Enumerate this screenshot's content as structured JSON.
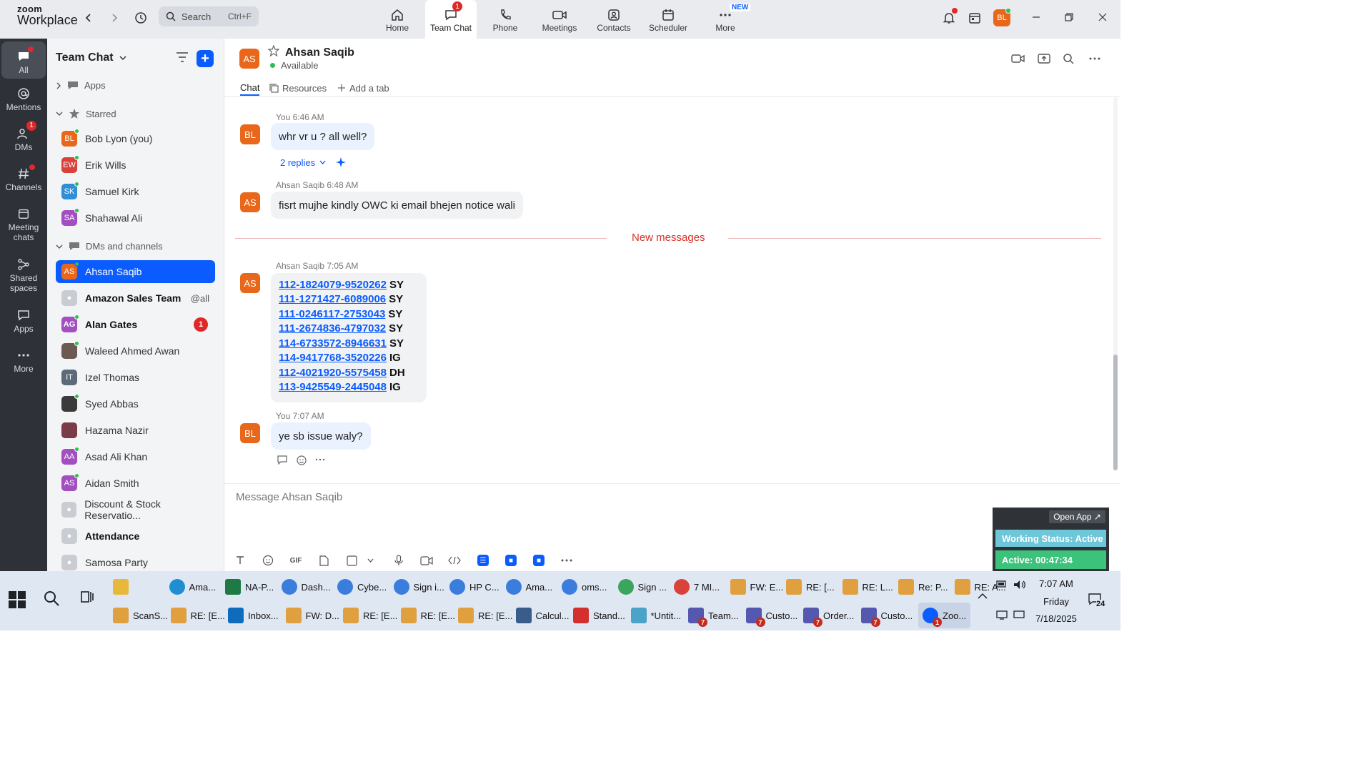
{
  "app": {
    "logo_line1": "zoom",
    "logo_line2": "Workplace"
  },
  "search": {
    "placeholder": "Search",
    "shortcut": "Ctrl+F"
  },
  "nav_tabs": [
    {
      "label": "Home",
      "icon": "home-icon"
    },
    {
      "label": "Team Chat",
      "icon": "chat-icon",
      "badge": "1"
    },
    {
      "label": "Phone",
      "icon": "phone-icon"
    },
    {
      "label": "Meetings",
      "icon": "video-icon"
    },
    {
      "label": "Contacts",
      "icon": "contacts-icon"
    },
    {
      "label": "Scheduler",
      "icon": "calendar-icon"
    },
    {
      "label": "More",
      "icon": "more-icon",
      "tag": "NEW"
    }
  ],
  "profile": {
    "initials": "BL"
  },
  "rail": [
    {
      "label": "All"
    },
    {
      "label": "Mentions"
    },
    {
      "label": "DMs",
      "badge": "1"
    },
    {
      "label": "Channels"
    },
    {
      "label": "Meeting chats"
    },
    {
      "label": "Shared spaces"
    },
    {
      "label": "Apps"
    },
    {
      "label": "More"
    }
  ],
  "sidebar": {
    "title": "Team Chat",
    "apps_label": "Apps",
    "starred_label": "Starred",
    "dms_label": "DMs and channels",
    "starred": [
      {
        "name": "Bob Lyon (you)",
        "initials": "BL",
        "color": "#e8671a"
      },
      {
        "name": "Erik Wills",
        "initials": "EW",
        "color": "#d9413a"
      },
      {
        "name": "Samuel Kirk",
        "initials": "SK",
        "color": "#2f8fd6"
      },
      {
        "name": "Shahawal Ali",
        "initials": "SA",
        "color": "#a34fc0"
      }
    ],
    "items": [
      {
        "name": "Ahsan Saqib",
        "initials": "AS",
        "color": "#e8671a"
      },
      {
        "name": "Amazon Sales Team",
        "trail": "@all"
      },
      {
        "name": "Alan Gates",
        "initials": "AG",
        "color": "#a34fc0",
        "count": "1"
      },
      {
        "name": "Waleed Ahmed Awan",
        "initials": "",
        "color": "#6a5a52"
      },
      {
        "name": "Izel Thomas",
        "initials": "IT",
        "color": "#5c6b7a"
      },
      {
        "name": "Syed Abbas",
        "initials": "",
        "color": "#3a3a3a"
      },
      {
        "name": "Hazama Nazir",
        "initials": "",
        "color": "#7a3c47"
      },
      {
        "name": "Asad Ali Khan",
        "initials": "AA",
        "color": "#a34fc0"
      },
      {
        "name": "Aidan Smith",
        "initials": "AS",
        "color": "#a34fc0"
      },
      {
        "name": "Discount & Stock Reservatio..."
      },
      {
        "name": "Attendance"
      },
      {
        "name": "Samosa Party"
      }
    ]
  },
  "chat": {
    "name": "Ahsan Saqib",
    "initials": "AS",
    "status": "Available",
    "tabs": [
      "Chat",
      "Resources",
      "Add a tab"
    ],
    "messages": [
      {
        "initials": "BL",
        "meta": "You 6:46 AM",
        "text": "whr vr u ? all well?",
        "replies": "2 replies"
      },
      {
        "initials": "AS",
        "meta": "Ahsan Saqib 6:48 AM",
        "text": "fisrt mujhe kindly OWC ki email bhejen notice wali"
      },
      {
        "initials": "AS",
        "meta": "Ahsan Saqib 7:05 AM"
      },
      {
        "initials": "BL",
        "meta": "You 7:07 AM",
        "text": "ye sb issue waly?"
      }
    ],
    "new_messages_label": "New messages",
    "orders": [
      {
        "id": "112-1824079-9520262",
        "tag": "SY"
      },
      {
        "id": "111-1271427-6089006",
        "tag": "SY"
      },
      {
        "id": "111-0246117-2753043",
        "tag": "SY"
      },
      {
        "id": "111-2674836-4797032",
        "tag": "SY"
      },
      {
        "id": "114-6733572-8946631",
        "tag": "SY"
      },
      {
        "id": "114-9417768-3520226",
        "tag": "IG"
      },
      {
        "id": "112-4021920-5575458",
        "tag": "DH"
      },
      {
        "id": "113-9425549-2445048",
        "tag": "IG"
      }
    ],
    "composer_placeholder": "Message Ahsan Saqib"
  },
  "widget": {
    "open_app": "Open App ↗",
    "working_status": "Working Status: Active",
    "active_time": "Active: 00:47:34"
  },
  "taskbar": {
    "row1": [
      {
        "label": "",
        "icon": "folder",
        "color": "#e8b83a"
      },
      {
        "label": "Ama...",
        "icon": "edge",
        "color": "#1f8fd1"
      },
      {
        "label": "NA-P...",
        "icon": "excel",
        "color": "#1d7a44"
      },
      {
        "label": "Dash...",
        "icon": "chrome",
        "color": "#3b7ddd"
      },
      {
        "label": "Cybe...",
        "icon": "chrome",
        "color": "#3b7ddd"
      },
      {
        "label": "Sign i...",
        "icon": "chrome",
        "color": "#3b7ddd"
      },
      {
        "label": "HP C...",
        "icon": "chrome",
        "color": "#3b7ddd"
      },
      {
        "label": "Ama...",
        "icon": "chrome",
        "color": "#3b7ddd"
      },
      {
        "label": "oms...",
        "icon": "chrome",
        "color": "#3b7ddd"
      },
      {
        "label": "Sign ...",
        "icon": "chrome",
        "color": "#3ba55d"
      },
      {
        "label": "7 MI...",
        "icon": "chrome",
        "color": "#d9413a"
      },
      {
        "label": "FW: E...",
        "icon": "mail",
        "color": "#e0a040"
      },
      {
        "label": "RE: [...",
        "icon": "mail",
        "color": "#e0a040"
      },
      {
        "label": "RE: L...",
        "icon": "mail",
        "color": "#e0a040"
      },
      {
        "label": "Re: P...",
        "icon": "mail",
        "color": "#e0a040"
      },
      {
        "label": "RE: A...",
        "icon": "mail",
        "color": "#e0a040"
      }
    ],
    "row2": [
      {
        "label": "ScanS...",
        "icon": "mail",
        "color": "#e0a040"
      },
      {
        "label": "RE: [E...",
        "icon": "mail",
        "color": "#e0a040"
      },
      {
        "label": "Inbox...",
        "icon": "outlook",
        "color": "#0f6cbd"
      },
      {
        "label": "FW: D...",
        "icon": "mail",
        "color": "#e0a040"
      },
      {
        "label": "RE: [E...",
        "icon": "mail",
        "color": "#e0a040"
      },
      {
        "label": "RE: [E...",
        "icon": "mail",
        "color": "#e0a040"
      },
      {
        "label": "RE: [E...",
        "icon": "mail",
        "color": "#e0a040"
      },
      {
        "label": "Calcul...",
        "icon": "calc",
        "color": "#3a5c8a"
      },
      {
        "label": "Stand...",
        "icon": "pdf",
        "color": "#d32f2f"
      },
      {
        "label": "*Untit...",
        "icon": "notepad",
        "color": "#4aa3c9"
      },
      {
        "label": "Team...",
        "icon": "teams",
        "color": "#5558af",
        "badge": "7"
      },
      {
        "label": "Custo...",
        "icon": "teams",
        "color": "#5558af",
        "badge": "7"
      },
      {
        "label": "Order...",
        "icon": "teams",
        "color": "#5558af",
        "badge": "7"
      },
      {
        "label": "Custo...",
        "icon": "teams",
        "color": "#5558af",
        "badge": "7"
      },
      {
        "label": "Zoo...",
        "icon": "zoom",
        "color": "#0b5cff",
        "badge": "1"
      }
    ],
    "time": "7:07 AM",
    "day": "Friday",
    "date": "7/18/2025",
    "notif_count": "24"
  },
  "colors": {
    "accent": "#0b5cff",
    "rail_bg": "#2e3138",
    "badge_red": "#e02828"
  }
}
